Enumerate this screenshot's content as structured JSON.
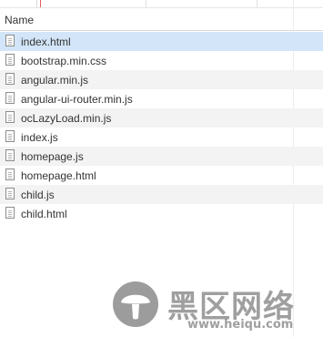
{
  "header": {
    "name_column": "Name"
  },
  "files": [
    {
      "name": "index.html"
    },
    {
      "name": "bootstrap.min.css"
    },
    {
      "name": "angular.min.js"
    },
    {
      "name": "angular-ui-router.min.js"
    },
    {
      "name": "ocLazyLoad.min.js"
    },
    {
      "name": "index.js"
    },
    {
      "name": "homepage.js"
    },
    {
      "name": "homepage.html"
    },
    {
      "name": "child.js"
    },
    {
      "name": "child.html"
    }
  ],
  "watermark": {
    "brand_text": "黑区网络",
    "url": "www.heiqu.com"
  },
  "colors": {
    "selected_row": "#d3e6f9",
    "stripe_row": "#f3f3f3",
    "timeline_marker": "#e35b5b"
  },
  "icons": {
    "file": "document-icon",
    "watermark": "mushroom-logo-icon"
  }
}
